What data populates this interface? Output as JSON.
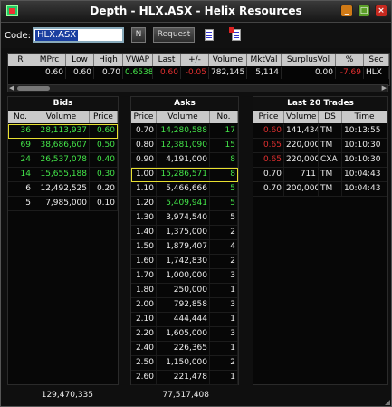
{
  "window": {
    "title": "Depth - HLX.ASX - Helix Resources",
    "min": "_",
    "max": "□",
    "close": "×"
  },
  "toolbar": {
    "code_label": "Code:",
    "code_value": "HLX.ASX",
    "n_label": "N",
    "request_label": "Request"
  },
  "quote": {
    "headers": [
      "R",
      "MPrc",
      "Low",
      "High",
      "VWAP",
      "Last",
      "+/-",
      "Volume",
      "MktVal",
      "SurplusVol",
      "%",
      "Sec"
    ],
    "values": [
      "",
      "0.60",
      "0.60",
      "0.70",
      "0.6538",
      "0.60",
      "-0.05",
      "782,145",
      "5,114",
      "0.00",
      "-7.69",
      "HLX"
    ]
  },
  "bids": {
    "title": "Bids",
    "headers": [
      "No.",
      "Volume",
      "Price"
    ],
    "rows": [
      [
        "36",
        "28,113,937",
        "0.60"
      ],
      [
        "69",
        "38,686,607",
        "0.50"
      ],
      [
        "24",
        "26,537,078",
        "0.40"
      ],
      [
        "14",
        "15,655,188",
        "0.30"
      ],
      [
        "6",
        "12,492,525",
        "0.20"
      ],
      [
        "5",
        "7,985,000",
        "0.10"
      ]
    ],
    "total": "129,470,335"
  },
  "asks": {
    "title": "Asks",
    "headers": [
      "Price",
      "Volume",
      "No."
    ],
    "rows": [
      [
        "0.70",
        "14,280,588",
        "17"
      ],
      [
        "0.80",
        "12,381,090",
        "15"
      ],
      [
        "0.90",
        "4,191,000",
        "8"
      ],
      [
        "1.00",
        "15,286,571",
        "8"
      ],
      [
        "1.10",
        "5,466,666",
        "5"
      ],
      [
        "1.20",
        "5,409,941",
        "5"
      ],
      [
        "1.30",
        "3,974,540",
        "5"
      ],
      [
        "1.40",
        "1,375,000",
        "2"
      ],
      [
        "1.50",
        "1,879,407",
        "4"
      ],
      [
        "1.60",
        "1,742,830",
        "2"
      ],
      [
        "1.70",
        "1,000,000",
        "3"
      ],
      [
        "1.80",
        "250,000",
        "1"
      ],
      [
        "2.00",
        "792,858",
        "3"
      ],
      [
        "2.10",
        "444,444",
        "1"
      ],
      [
        "2.20",
        "1,605,000",
        "3"
      ],
      [
        "2.40",
        "226,365",
        "1"
      ],
      [
        "2.50",
        "1,150,000",
        "2"
      ],
      [
        "2.60",
        "221,478",
        "1"
      ]
    ],
    "total": "77,517,408"
  },
  "trades": {
    "title": "Last 20 Trades",
    "headers": [
      "Price",
      "Volume",
      "DS",
      "Time"
    ],
    "rows": [
      [
        "0.60",
        "141,434",
        "TM",
        "10:13:55"
      ],
      [
        "0.65",
        "220,000",
        "TM",
        "10:10:30"
      ],
      [
        "0.65",
        "220,000",
        "CXA",
        "10:10:30"
      ],
      [
        "0.70",
        "711",
        "TM",
        "10:04:43"
      ],
      [
        "0.70",
        "200,000",
        "TM",
        "10:04:43"
      ]
    ]
  },
  "colors": {
    "up": "#44e64a",
    "down": "#e23030",
    "highlight": "#e8e030"
  }
}
